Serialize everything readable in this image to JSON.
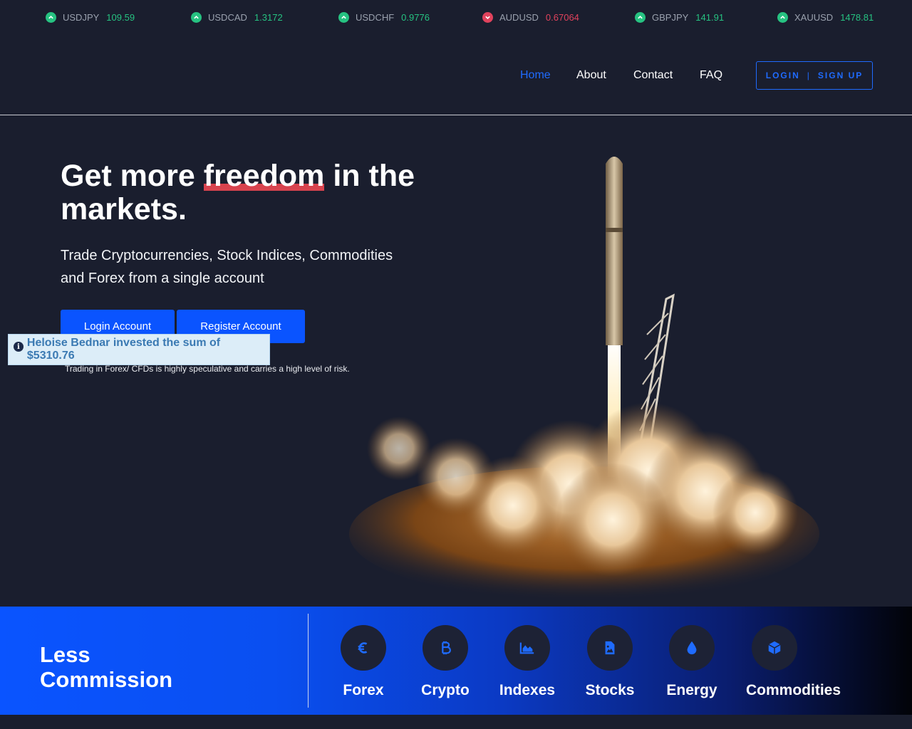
{
  "ticker": [
    {
      "symbol": "USDJPY",
      "value": "109.59",
      "trend": "up"
    },
    {
      "symbol": "USDCAD",
      "value": "1.3172",
      "trend": "up"
    },
    {
      "symbol": "USDCHF",
      "value": "0.9776",
      "trend": "up"
    },
    {
      "symbol": "AUDUSD",
      "value": "0.67064",
      "trend": "down"
    },
    {
      "symbol": "GBPJPY",
      "value": "141.91",
      "trend": "up"
    },
    {
      "symbol": "XAUUSD",
      "value": "1478.81",
      "trend": "up"
    }
  ],
  "nav": {
    "links": [
      {
        "label": "Home",
        "active": true
      },
      {
        "label": "About",
        "active": false
      },
      {
        "label": "Contact",
        "active": false
      },
      {
        "label": "FAQ",
        "active": false
      }
    ],
    "login_label": "LOGIN",
    "separator": "|",
    "signup_label": "SIGN UP"
  },
  "hero": {
    "title_before": "Get more ",
    "title_highlight": "freedom",
    "title_after": " in the markets.",
    "subtitle": "Trade Cryptocurrencies, Stock Indices, Commodities and Forex from a single account",
    "login_button": "Login Account",
    "register_button": "Register Account",
    "risk_note": "Trading in Forex/ CFDs is highly speculative and carries a high level of risk."
  },
  "toast": {
    "message": "Heloise Bednar invested the sum of $5310.76",
    "icon": "info-icon"
  },
  "band": {
    "title": "Less Commission",
    "categories": [
      {
        "label": "Forex",
        "icon": "euro-icon"
      },
      {
        "label": "Crypto",
        "icon": "bitcoin-icon"
      },
      {
        "label": "Indexes",
        "icon": "area-chart-icon"
      },
      {
        "label": "Stocks",
        "icon": "document-image-icon"
      },
      {
        "label": "Energy",
        "icon": "droplet-icon"
      },
      {
        "label": "Commodities",
        "icon": "cube-icon"
      }
    ]
  },
  "colors": {
    "accent": "#1f6bff",
    "up": "#26c281",
    "down": "#e0425c",
    "highlight": "#d8434e",
    "background": "#1a1e2e"
  }
}
